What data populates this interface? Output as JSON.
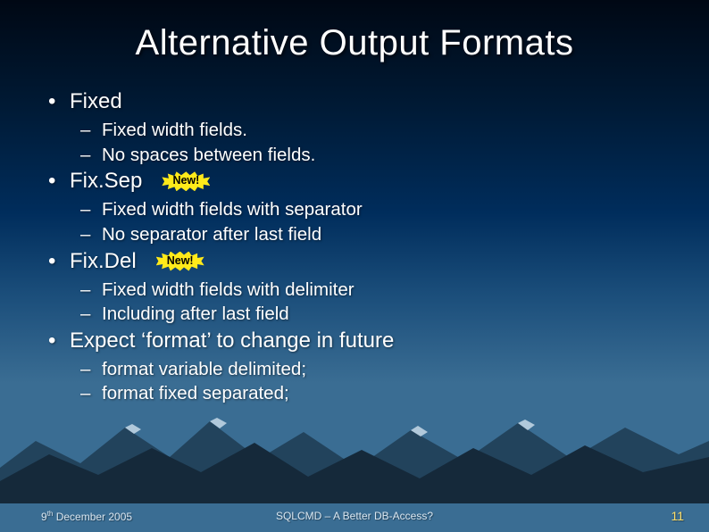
{
  "title": "Alternative Output Formats",
  "sections": [
    {
      "heading": "Fixed",
      "badge": null,
      "sub": [
        "Fixed width fields.",
        "No spaces between fields."
      ]
    },
    {
      "heading": "Fix.Sep",
      "badge": "New!",
      "sub": [
        "Fixed width fields with separator",
        "No separator after last field"
      ]
    },
    {
      "heading": "Fix.Del",
      "badge": "New!",
      "sub": [
        "Fixed width fields with delimiter",
        "Including after last field"
      ]
    },
    {
      "heading": "Expect ‘format’ to change in future",
      "badge": null,
      "sub": [
        "format variable delimited;",
        "format fixed separated;"
      ]
    }
  ],
  "footer": {
    "date_day": "9",
    "date_ord": "th",
    "date_rest": " December 2005",
    "center": "SQLCMD – A Better DB-Access?",
    "page": "11"
  }
}
